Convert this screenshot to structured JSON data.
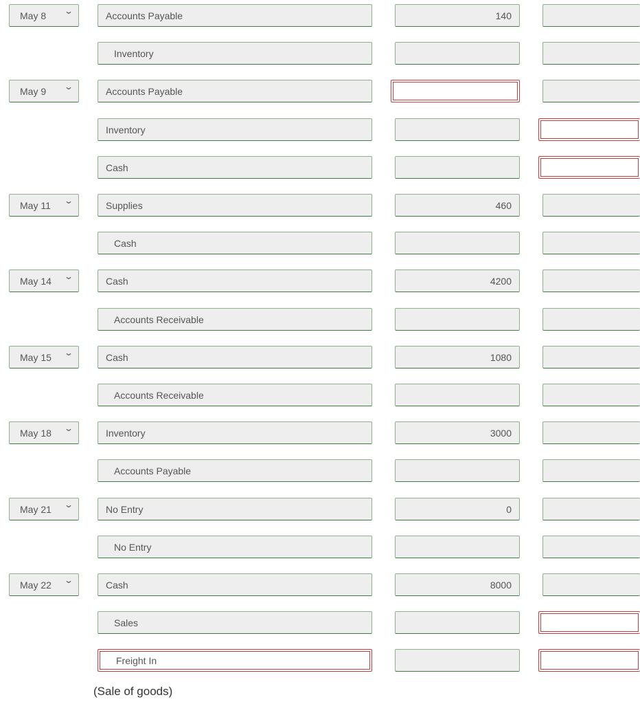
{
  "colors": {
    "field_bg": "#eeeeee",
    "valid_border": "#3e7d3e",
    "error_border": "#b94040"
  },
  "rows": [
    {
      "date": "May 8",
      "account": "Accounts Payable",
      "indent": false,
      "debit": "140",
      "credit": "",
      "debit_error": false,
      "credit_error": false,
      "account_error": false
    },
    {
      "date": null,
      "account": "Inventory",
      "indent": true,
      "debit": "",
      "credit": "",
      "debit_error": false,
      "credit_error": false,
      "account_error": false
    },
    {
      "date": "May 9",
      "account": "Accounts Payable",
      "indent": false,
      "debit": "",
      "credit": "",
      "debit_error": true,
      "credit_error": false,
      "account_error": false
    },
    {
      "date": null,
      "account": "Inventory",
      "indent": false,
      "debit": "",
      "credit": "",
      "debit_error": false,
      "credit_error": true,
      "account_error": false
    },
    {
      "date": null,
      "account": "Cash",
      "indent": false,
      "debit": "",
      "credit": "",
      "debit_error": false,
      "credit_error": true,
      "account_error": false
    },
    {
      "date": "May 11",
      "account": "Supplies",
      "indent": false,
      "debit": "460",
      "credit": "",
      "debit_error": false,
      "credit_error": false,
      "account_error": false
    },
    {
      "date": null,
      "account": "Cash",
      "indent": true,
      "debit": "",
      "credit": "",
      "debit_error": false,
      "credit_error": false,
      "account_error": false
    },
    {
      "date": "May 14",
      "account": "Cash",
      "indent": false,
      "debit": "4200",
      "credit": "",
      "debit_error": false,
      "credit_error": false,
      "account_error": false
    },
    {
      "date": null,
      "account": "Accounts Receivable",
      "indent": true,
      "debit": "",
      "credit": "",
      "debit_error": false,
      "credit_error": false,
      "account_error": false
    },
    {
      "date": "May 15",
      "account": "Cash",
      "indent": false,
      "debit": "1080",
      "credit": "",
      "debit_error": false,
      "credit_error": false,
      "account_error": false
    },
    {
      "date": null,
      "account": "Accounts Receivable",
      "indent": true,
      "debit": "",
      "credit": "",
      "debit_error": false,
      "credit_error": false,
      "account_error": false
    },
    {
      "date": "May 18",
      "account": "Inventory",
      "indent": false,
      "debit": "3000",
      "credit": "",
      "debit_error": false,
      "credit_error": false,
      "account_error": false
    },
    {
      "date": null,
      "account": "Accounts Payable",
      "indent": true,
      "debit": "",
      "credit": "",
      "debit_error": false,
      "credit_error": false,
      "account_error": false
    },
    {
      "date": "May 21",
      "account": "No Entry",
      "indent": false,
      "debit": "0",
      "credit": "",
      "debit_error": false,
      "credit_error": false,
      "account_error": false
    },
    {
      "date": null,
      "account": "No Entry",
      "indent": true,
      "debit": "",
      "credit": "",
      "debit_error": false,
      "credit_error": false,
      "account_error": false
    },
    {
      "date": "May 22",
      "account": "Cash",
      "indent": false,
      "debit": "8000",
      "credit": "",
      "debit_error": false,
      "credit_error": false,
      "account_error": false
    },
    {
      "date": null,
      "account": "Sales",
      "indent": true,
      "debit": "",
      "credit": "",
      "debit_error": false,
      "credit_error": true,
      "account_error": false
    },
    {
      "date": null,
      "account": "Freight In",
      "indent": true,
      "debit": "",
      "credit": "",
      "debit_error": false,
      "credit_error": true,
      "account_error": true
    }
  ],
  "caption": "(Sale of goods)"
}
